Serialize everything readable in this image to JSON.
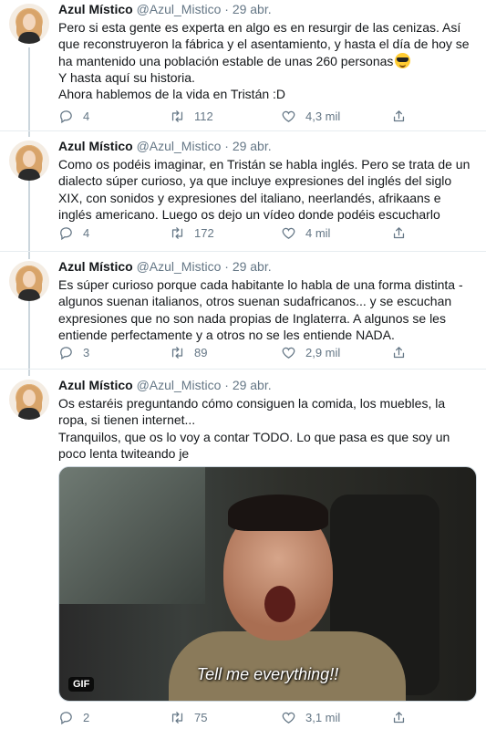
{
  "tweets": [
    {
      "name": "Azul Místico",
      "handle": "@Azul_Mistico",
      "separator": "·",
      "date": "29 abr.",
      "lines": [
        "Pero si esta gente es experta en algo es en resurgir de las cenizas. Así",
        "que reconstruyeron la fábrica y el asentamiento, y hasta el día de hoy se",
        "ha mantenido una población estable de unas 260 personas",
        "Y hasta aquí su historia.",
        "Ahora hablemos de la vida en Tristán :D"
      ],
      "emoji": "sunglasses-emoji",
      "replies": "4",
      "retweets": "112",
      "likes": "4,3 mil"
    },
    {
      "name": "Azul Místico",
      "handle": "@Azul_Mistico",
      "separator": "·",
      "date": "29 abr.",
      "lines": [
        "Como os podéis imaginar, en Tristán se habla inglés. Pero se trata de un",
        "dialecto súper curioso, ya que incluye expresiones del inglés del siglo",
        "XIX, con sonidos y expresiones del italiano, neerlandés, afrikaans e",
        "inglés americano. Luego os dejo un vídeo donde podéis escucharlo"
      ],
      "replies": "4",
      "retweets": "172",
      "likes": "4 mil"
    },
    {
      "name": "Azul Místico",
      "handle": "@Azul_Mistico",
      "separator": "·",
      "date": "29 abr.",
      "lines": [
        "Es súper curioso porque cada habitante lo habla de una forma distinta -",
        "algunos suenan italianos, otros suenan sudafricanos... y se escuchan",
        "expresiones que no son nada propias de Inglaterra. A algunos se les",
        "entiende perfectamente y a otros no se les entiende NADA."
      ],
      "replies": "3",
      "retweets": "89",
      "likes": "2,9 mil"
    },
    {
      "name": "Azul Místico",
      "handle": "@Azul_Mistico",
      "separator": "·",
      "date": "29 abr.",
      "lines": [
        "Os estaréis preguntando cómo consiguen la comida, los muebles, la",
        "ropa, si tienen internet...",
        "Tranquilos, que os lo voy a contar TODO. Lo que pasa es que soy un",
        "poco lenta twiteando je"
      ],
      "media": {
        "badge": "GIF",
        "caption": "Tell me everything!!"
      },
      "replies": "2",
      "retweets": "75",
      "likes": "3,1 mil"
    }
  ],
  "icons": {
    "reply": "reply-icon",
    "retweet": "retweet-icon",
    "like": "heart-icon",
    "share": "share-icon"
  },
  "colors": {
    "text": "#14171a",
    "secondary": "#657786",
    "divider": "#e6ecf0",
    "thread": "#ccd6dd"
  }
}
